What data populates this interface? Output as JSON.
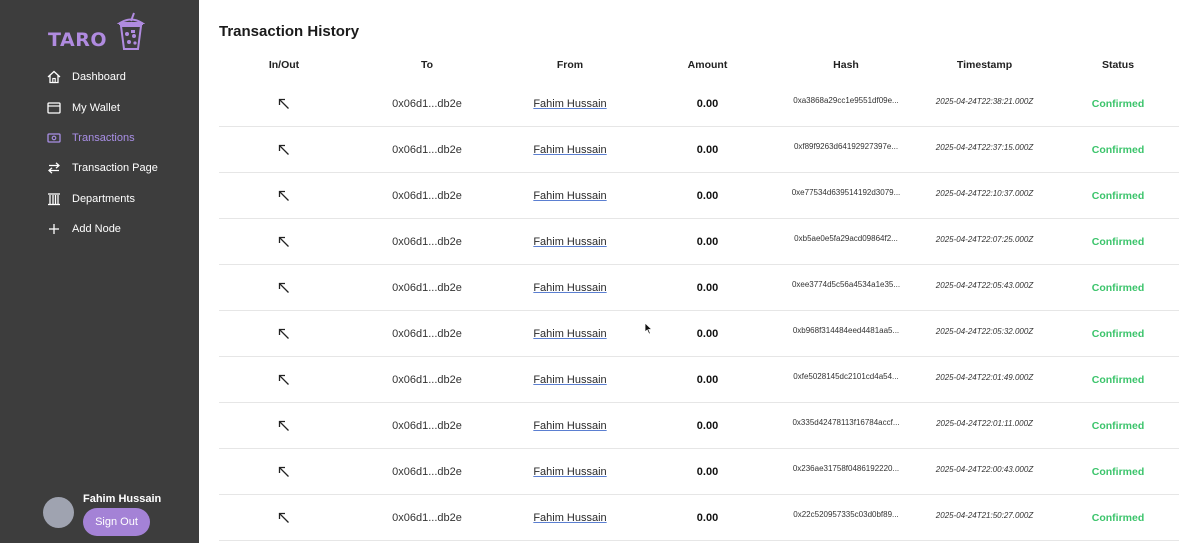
{
  "brand": {
    "name": "TARO",
    "accent": "#b08be0"
  },
  "sidebar": {
    "items": [
      {
        "label": "Dashboard",
        "icon": "home-icon"
      },
      {
        "label": "My Wallet",
        "icon": "wallet-icon"
      },
      {
        "label": "Transactions",
        "icon": "transactions-icon",
        "active": true
      },
      {
        "label": "Transaction Page",
        "icon": "swap-arrows-icon"
      },
      {
        "label": "Departments",
        "icon": "building-columns-icon"
      },
      {
        "label": "Add Node",
        "icon": "plus-icon"
      }
    ]
  },
  "user": {
    "name": "Fahim Hussain",
    "signout_label": "Sign Out"
  },
  "main": {
    "title": "Transaction History",
    "columns": [
      "In/Out",
      "To",
      "From",
      "Amount",
      "Hash",
      "Timestamp",
      "Status"
    ],
    "rows": [
      {
        "direction_icon": "arrow-up-left-icon",
        "to": "0x06d1...db2e",
        "from": "Fahim Hussain",
        "amount": "0.00",
        "hash": "0xa3868a29cc1e9551df09e...",
        "timestamp": "2025-04-24T22:38:21.000Z",
        "status": "Confirmed"
      },
      {
        "direction_icon": "arrow-up-left-icon",
        "to": "0x06d1...db2e",
        "from": "Fahim Hussain",
        "amount": "0.00",
        "hash": "0xf89f9263d64192927397e...",
        "timestamp": "2025-04-24T22:37:15.000Z",
        "status": "Confirmed"
      },
      {
        "direction_icon": "arrow-up-left-icon",
        "to": "0x06d1...db2e",
        "from": "Fahim Hussain",
        "amount": "0.00",
        "hash": "0xe77534d639514192d3079...",
        "timestamp": "2025-04-24T22:10:37.000Z",
        "status": "Confirmed"
      },
      {
        "direction_icon": "arrow-up-left-icon",
        "to": "0x06d1...db2e",
        "from": "Fahim Hussain",
        "amount": "0.00",
        "hash": "0xb5ae0e5fa29acd09864f2...",
        "timestamp": "2025-04-24T22:07:25.000Z",
        "status": "Confirmed"
      },
      {
        "direction_icon": "arrow-up-left-icon",
        "to": "0x06d1...db2e",
        "from": "Fahim Hussain",
        "amount": "0.00",
        "hash": "0xee3774d5c56a4534a1e35...",
        "timestamp": "2025-04-24T22:05:43.000Z",
        "status": "Confirmed"
      },
      {
        "direction_icon": "arrow-up-left-icon",
        "to": "0x06d1...db2e",
        "from": "Fahim Hussain",
        "amount": "0.00",
        "hash": "0xb968f314484eed4481aa5...",
        "timestamp": "2025-04-24T22:05:32.000Z",
        "status": "Confirmed"
      },
      {
        "direction_icon": "arrow-up-left-icon",
        "to": "0x06d1...db2e",
        "from": "Fahim Hussain",
        "amount": "0.00",
        "hash": "0xfe5028145dc2101cd4a54...",
        "timestamp": "2025-04-24T22:01:49.000Z",
        "status": "Confirmed"
      },
      {
        "direction_icon": "arrow-up-left-icon",
        "to": "0x06d1...db2e",
        "from": "Fahim Hussain",
        "amount": "0.00",
        "hash": "0x335d42478113f16784accf...",
        "timestamp": "2025-04-24T22:01:11.000Z",
        "status": "Confirmed"
      },
      {
        "direction_icon": "arrow-up-left-icon",
        "to": "0x06d1...db2e",
        "from": "Fahim Hussain",
        "amount": "0.00",
        "hash": "0x236ae31758f0486192220...",
        "timestamp": "2025-04-24T22:00:43.000Z",
        "status": "Confirmed"
      },
      {
        "direction_icon": "arrow-up-left-icon",
        "to": "0x06d1...db2e",
        "from": "Fahim Hussain",
        "amount": "0.00",
        "hash": "0x22c520957335c03d0bf89...",
        "timestamp": "2025-04-24T21:50:27.000Z",
        "status": "Confirmed"
      }
    ]
  },
  "colors": {
    "sidebar_bg": "#3d3d3d",
    "active_nav": "#a98fe6",
    "status_confirmed": "#3bc46b",
    "signout_bg": "#a482d6"
  }
}
